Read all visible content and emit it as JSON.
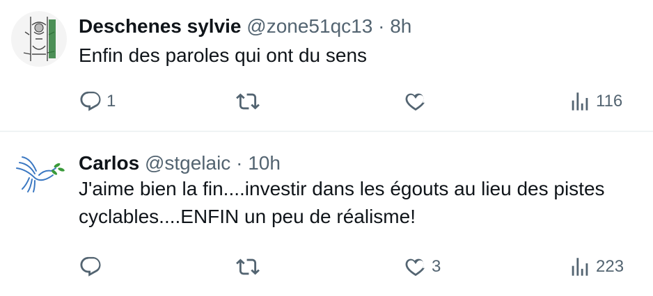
{
  "tweets": [
    {
      "author_name": "Deschenes sylvie",
      "handle": "@zone51qc13",
      "separator": "·",
      "time": "8h",
      "text": "Enfin des paroles qui ont du sens",
      "reply_count": "1",
      "retweet_count": "",
      "like_count": "",
      "view_count": "116"
    },
    {
      "author_name": "Carlos",
      "handle": "@stgelaic",
      "separator": "·",
      "time": "10h",
      "text": "J'aime bien la fin....investir dans les égouts au lieu des pistes cyclables....ENFIN un peu de réalisme!",
      "reply_count": "",
      "retweet_count": "",
      "like_count": "3",
      "view_count": "223"
    }
  ],
  "colors": {
    "text": "#0f1419",
    "secondary": "#536471",
    "divider": "#eff3f4",
    "dove": "#3b78c2"
  },
  "icons": [
    "reply-icon",
    "retweet-icon",
    "like-icon",
    "views-icon"
  ]
}
